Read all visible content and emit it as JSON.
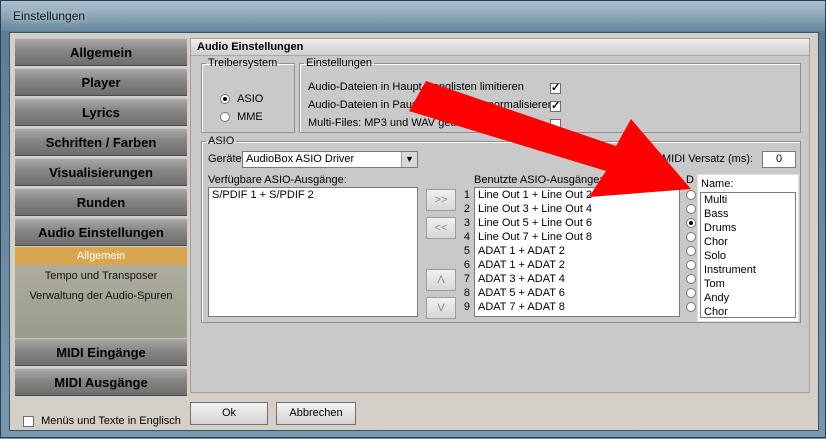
{
  "window": {
    "title": "Einstellungen"
  },
  "sidebar": {
    "items": [
      {
        "label": "Allgemein"
      },
      {
        "label": "Player"
      },
      {
        "label": "Lyrics"
      },
      {
        "label": "Schriften / Farben"
      },
      {
        "label": "Visualisierungen"
      },
      {
        "label": "Runden"
      },
      {
        "label": "Audio Einstellungen"
      }
    ],
    "sub_items": [
      {
        "label": "Allgemein",
        "active": true
      },
      {
        "label": "Tempo und Transposer",
        "active": false
      },
      {
        "label": "Verwaltung der Audio-Spuren",
        "active": false
      }
    ],
    "bottom_items": [
      {
        "label": "MIDI Eingänge"
      },
      {
        "label": "MIDI Ausgänge"
      }
    ],
    "english_checkbox_label": "Menüs und Texte in Englisch",
    "english_checked": false
  },
  "main": {
    "header": "Audio Einstellungen",
    "treibersystem": {
      "legend": "Treibersystem",
      "options": [
        {
          "label": "ASIO",
          "selected": true
        },
        {
          "label": "MME",
          "selected": false
        }
      ]
    },
    "einstellungen": {
      "legend": "Einstellungen",
      "options": [
        {
          "label": "Audio-Dateien in Haupt-Songlisten limitieren",
          "checked": true
        },
        {
          "label": "Audio-Dateien in Pausen-Songlisten normalisieren",
          "checked": true
        },
        {
          "label": "Multi-Files: MP3 und WAV getrennt",
          "checked": false
        }
      ]
    },
    "asio": {
      "legend": "ASIO",
      "geraete_label": "Geräte",
      "device": "AudioBox ASIO Driver",
      "midi_versatz_label": "MIDI Versatz (ms):",
      "midi_versatz_value": "0",
      "available_label": "Verfügbare ASIO-Ausgänge:",
      "available": [
        "S/PDIF 1 + S/PDIF 2"
      ],
      "used_label": "Benutzte ASIO-Ausgänge:",
      "d_label": "D",
      "name_label": "Name:",
      "move_right": ">>",
      "move_left": "<<",
      "move_up": "Λ",
      "move_down": "V",
      "used": [
        {
          "num": "1",
          "label": "Line Out 1 + Line Out 2",
          "d": false,
          "name": "Multi"
        },
        {
          "num": "2",
          "label": "Line Out 3 + Line Out 4",
          "d": false,
          "name": "Bass"
        },
        {
          "num": "3",
          "label": "Line Out 5 + Line Out 6",
          "d": true,
          "name": "Drums"
        },
        {
          "num": "4",
          "label": "Line Out 7 + Line Out 8",
          "d": false,
          "name": "Chor"
        },
        {
          "num": "5",
          "label": "ADAT 1 + ADAT 2",
          "d": false,
          "name": "Solo"
        },
        {
          "num": "6",
          "label": "ADAT 1 + ADAT 2",
          "d": false,
          "name": "Instrument"
        },
        {
          "num": "7",
          "label": "ADAT 3 + ADAT 4",
          "d": false,
          "name": "Tom"
        },
        {
          "num": "8",
          "label": "ADAT 5 + ADAT 6",
          "d": false,
          "name": "Andy"
        },
        {
          "num": "9",
          "label": "ADAT 7 + ADAT 8",
          "d": false,
          "name": "Chor"
        }
      ]
    }
  },
  "footer": {
    "ok": "Ok",
    "cancel": "Abbrechen"
  },
  "colors": {
    "annotation_arrow": "#ff0000",
    "active_sub_item": "#d9a54e"
  }
}
